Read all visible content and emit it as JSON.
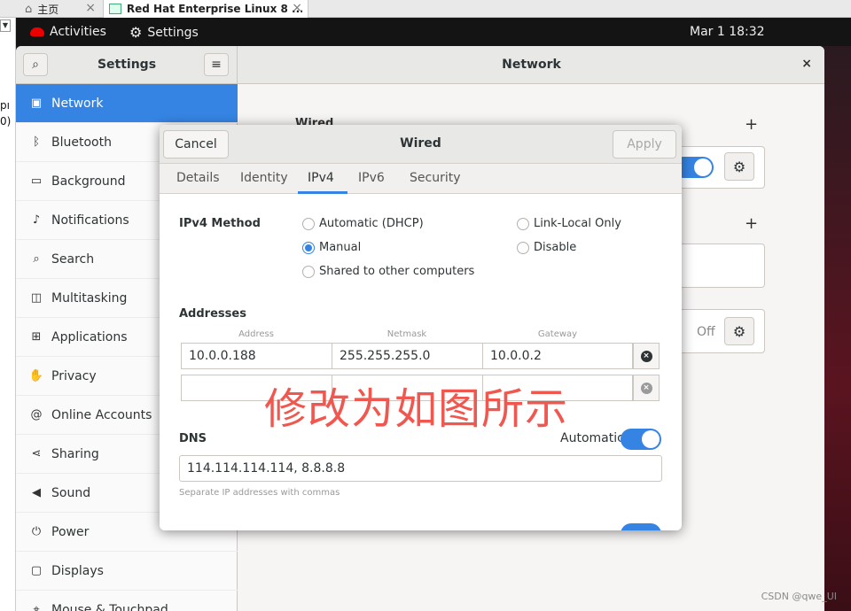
{
  "host": {
    "tab_home": "主页",
    "tab_vm": "Red Hat Enterprise Linux 8 ...",
    "left_frag_1": "pı",
    "left_frag_2": "0)"
  },
  "topbar": {
    "activities": "Activities",
    "app": "Settings",
    "clock": "Mar 1  18:32"
  },
  "window": {
    "left_title": "Settings",
    "title": "Network",
    "close": "×"
  },
  "sidebar": {
    "items": [
      {
        "label": "Network",
        "icon": "network-icon",
        "glyph": "▣"
      },
      {
        "label": "Bluetooth",
        "icon": "bluetooth-icon",
        "glyph": "ᛒ"
      },
      {
        "label": "Background",
        "icon": "background-icon",
        "glyph": "▭"
      },
      {
        "label": "Notifications",
        "icon": "bell-icon",
        "glyph": "♪"
      },
      {
        "label": "Search",
        "icon": "search-icon",
        "glyph": "⌕"
      },
      {
        "label": "Multitasking",
        "icon": "multitasking-icon",
        "glyph": "◫"
      },
      {
        "label": "Applications",
        "icon": "applications-icon",
        "glyph": "⊞"
      },
      {
        "label": "Privacy",
        "icon": "hand-icon",
        "glyph": "✋"
      },
      {
        "label": "Online Accounts",
        "icon": "online-accounts-icon",
        "glyph": "@"
      },
      {
        "label": "Sharing",
        "icon": "share-icon",
        "glyph": "⋖"
      },
      {
        "label": "Sound",
        "icon": "speaker-icon",
        "glyph": "◀"
      },
      {
        "label": "Power",
        "icon": "power-icon",
        "glyph": "⏻"
      },
      {
        "label": "Displays",
        "icon": "display-icon",
        "glyph": "▢"
      },
      {
        "label": "Mouse & Touchpad",
        "icon": "mouse-icon",
        "glyph": "⌖"
      }
    ]
  },
  "background_panel": {
    "wired_label": "Wired",
    "off_label": "Off"
  },
  "dialog": {
    "cancel": "Cancel",
    "title": "Wired",
    "apply": "Apply",
    "tabs": [
      "Details",
      "Identity",
      "IPv4",
      "IPv6",
      "Security"
    ],
    "active_tab": "IPv4",
    "method_label": "IPv4 Method",
    "methods": [
      {
        "label": "Automatic (DHCP)",
        "selected": false
      },
      {
        "label": "Manual",
        "selected": true
      },
      {
        "label": "Shared to other computers",
        "selected": false
      },
      {
        "label": "Link-Local Only",
        "selected": false
      },
      {
        "label": "Disable",
        "selected": false
      }
    ],
    "addresses_label": "Addresses",
    "columns": [
      "Address",
      "Netmask",
      "Gateway"
    ],
    "rows": [
      [
        "10.0.0.188",
        "255.255.255.0",
        "10.0.0.2"
      ],
      [
        "",
        "",
        ""
      ]
    ],
    "dns_label": "DNS",
    "dns_automatic_label": "Automatic",
    "dns_automatic_on": true,
    "dns_value": "114.114.114.114, 8.8.8.8",
    "dns_hint": "Separate IP addresses with commas"
  },
  "annotation": "修改为如图所示",
  "watermark": "CSDN @qwe_UI",
  "colors": {
    "accent": "#3584e4",
    "annotation": "#f0574f",
    "topbar": "#141414"
  }
}
